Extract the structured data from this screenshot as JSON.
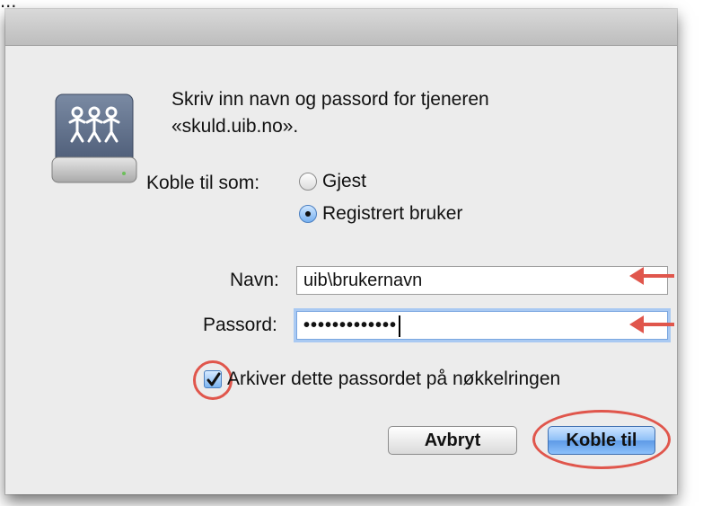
{
  "caption": "... ",
  "dialog": {
    "prompt_line1": "Skriv inn navn og passord for tjeneren",
    "prompt_line2": "«skuld.uib.no».",
    "connect_as_label": "Koble til som:",
    "options": [
      {
        "label": "Gjest",
        "selected": false
      },
      {
        "label": "Registrert bruker",
        "selected": true
      }
    ],
    "name_label": "Navn:",
    "name_value": "uib\\brukernavn",
    "password_label": "Passord:",
    "password_value": "•••••••••••••",
    "keychain_label": "Arkiver dette passordet på nøkkelringen",
    "keychain_checked": true,
    "cancel_label": "Avbryt",
    "connect_label": "Koble til"
  },
  "icons": {
    "server": "network-server-icon",
    "arrow": "red-arrow-icon"
  },
  "colors": {
    "highlight": "#e0564c",
    "focus": "#a9c9f2",
    "default_button": "#5e9ae6"
  }
}
